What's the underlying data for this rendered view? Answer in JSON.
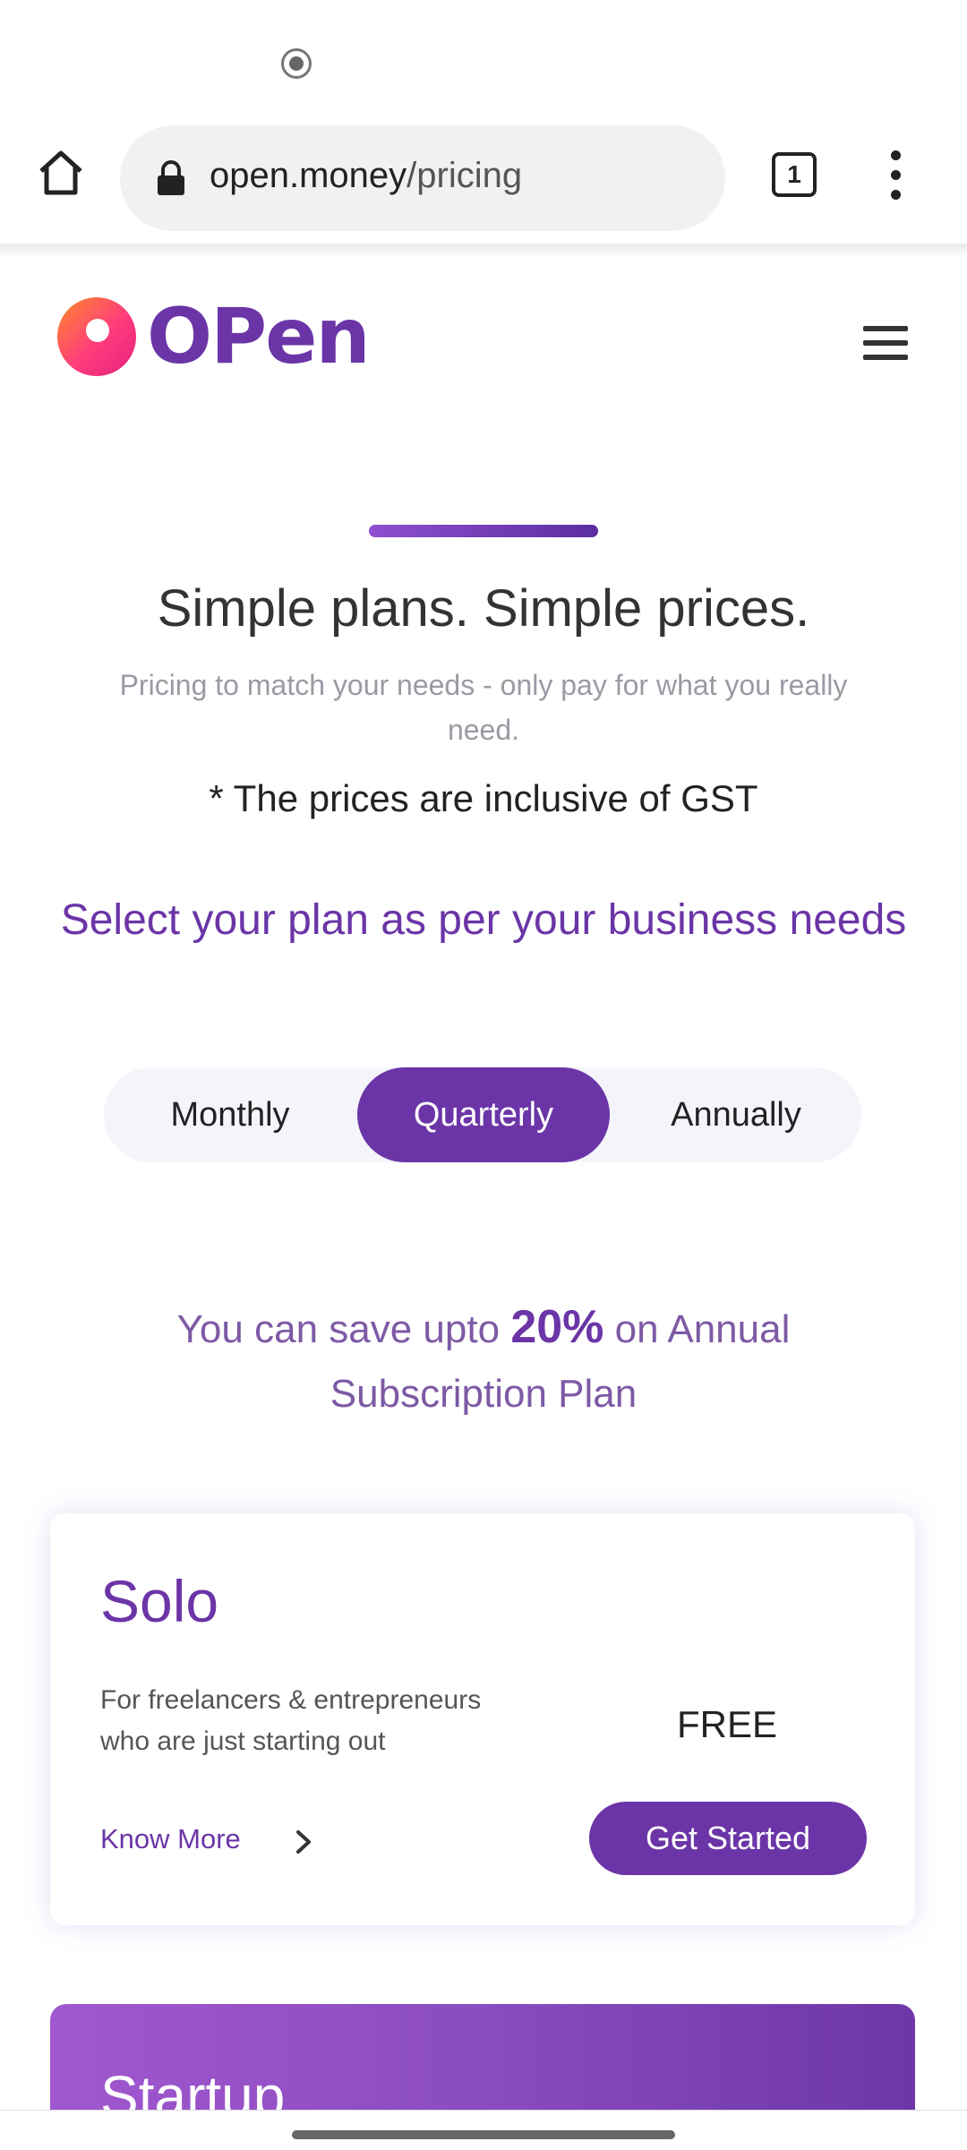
{
  "browser": {
    "url_domain": "open.money",
    "url_path": "/pricing",
    "tab_count": "1"
  },
  "site": {
    "logo_text": "OPen"
  },
  "hero": {
    "headline": "Simple plans. Simple prices.",
    "subtext": "Pricing to match your needs - only pay for what you really need.",
    "gst_note": "* The prices are inclusive of GST",
    "plan_heading": "Select your plan as per your business needs"
  },
  "billing_toggle": {
    "options": [
      "Monthly",
      "Quarterly",
      "Annually"
    ],
    "selected": "Quarterly"
  },
  "savings": {
    "prefix": "You can save upto",
    "percent": "20%",
    "suffix": "on Annual Subscription Plan"
  },
  "plans": [
    {
      "name": "Solo",
      "description": "For freelancers & entrepreneurs who are just starting out",
      "know_more": "Know More",
      "price": "FREE",
      "cta": "Get Started"
    },
    {
      "name": "Startup"
    }
  ],
  "colors": {
    "brand_purple": "#6b35a7",
    "accent_gradient_start": "#8e4fd0",
    "logo_orange": "#ff8a2a",
    "logo_pink": "#e4207f"
  },
  "icons": [
    "record-icon",
    "home-icon",
    "lock-icon",
    "tabs-icon",
    "more-vert-icon",
    "hamburger-menu-icon",
    "chevron-right-icon"
  ]
}
